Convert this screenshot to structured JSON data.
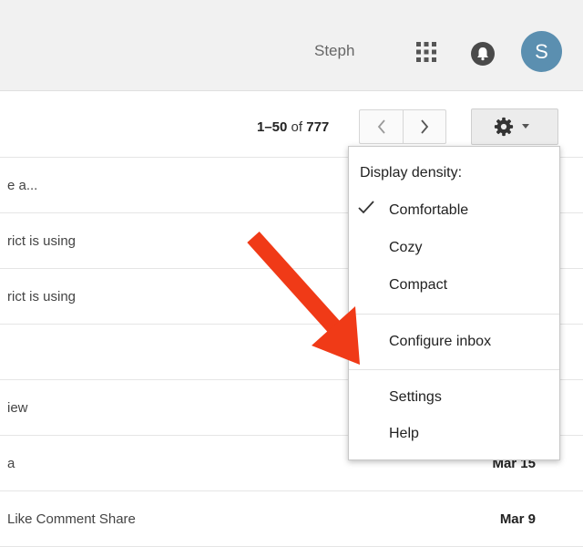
{
  "header": {
    "username": "Steph",
    "avatar_letter": "S",
    "apps_icon": "apps-grid-icon",
    "notifications_icon": "bell-icon"
  },
  "toolbar": {
    "range": "1–50",
    "of_text": "of",
    "total": "777",
    "prev_icon": "chevron-left-icon",
    "next_icon": "chevron-right-icon",
    "settings_icon": "gear-icon"
  },
  "menu": {
    "heading": "Display density:",
    "density_options": [
      "Comfortable",
      "Cozy",
      "Compact"
    ],
    "selected": "Comfortable",
    "configure": "Configure inbox",
    "settings": "Settings",
    "help": "Help"
  },
  "emails": [
    {
      "snippet": "e a...",
      "date": ""
    },
    {
      "snippet": "rict is using",
      "date": ""
    },
    {
      "snippet": "rict is using",
      "date": ""
    },
    {
      "snippet": "",
      "date": ""
    },
    {
      "snippet": "iew",
      "date": ""
    },
    {
      "snippet": "a",
      "date": "Mar 15"
    },
    {
      "snippet": "Like Comment Share",
      "date": "Mar 9"
    }
  ],
  "colors": {
    "avatar": "#5b8fb0",
    "arrow": "#f03a17",
    "header_bg": "#f1f1f1"
  }
}
